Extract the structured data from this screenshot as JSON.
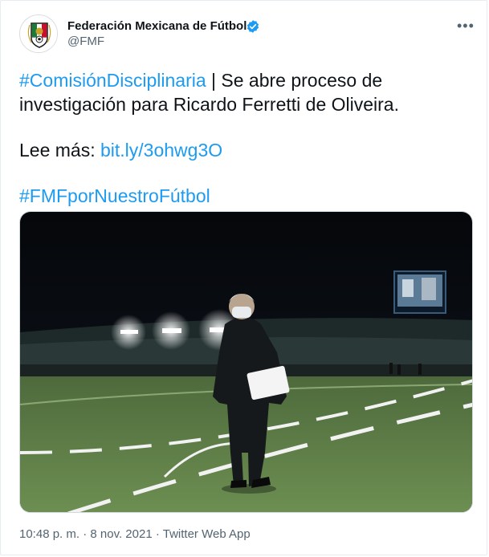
{
  "author": {
    "name": "Federación Mexicana de Fútbol",
    "handle": "@FMF",
    "verified": true
  },
  "tweet": {
    "hashtag1": "#ComisiónDisciplinaria",
    "separator": " | ",
    "line1_rest": "Se abre proceso de investigación para Ricardo Ferretti de Oliveira.",
    "read_more_label": "Lee más: ",
    "read_more_link": "bit.ly/3ohwg3O",
    "hashtag2": "#FMFporNuestroFútbol"
  },
  "meta": {
    "time": "10:48 p. m.",
    "dot1": " · ",
    "date": "8 nov. 2021",
    "dot2": " · ",
    "source": "Twitter Web App"
  },
  "colors": {
    "link": "#1d9bf0",
    "text": "#0f1419",
    "secondary": "#536471"
  }
}
